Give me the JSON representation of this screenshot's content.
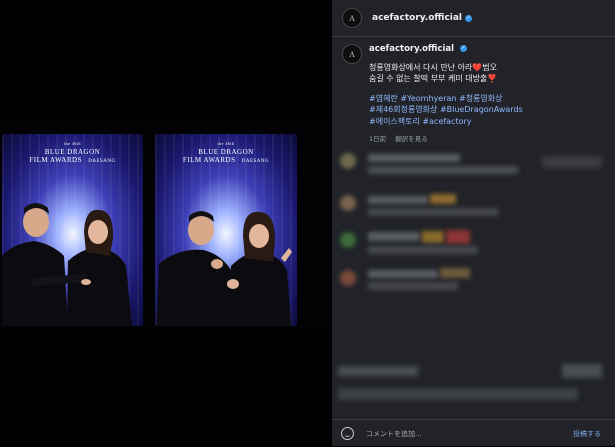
{
  "post": {
    "username": "acefactory.official",
    "caption_user": "acefactory.official",
    "caption_line1": "청룡영화상에서 다시 만난 아라❤️범오",
    "caption_line2": "숨길 수 없는 찰떡 부부 케미 대방출❣️",
    "hashtags_line1": "#염혜란 #Yeomhyeran #청룡영화상",
    "hashtags_line2": "#제46회청룡영화상 #BlueDragonAwards",
    "hashtags_line3": "#에이스팩토리 #acefactory",
    "time_ago": "1日前",
    "translate_label": "翻訳を見る",
    "avatar_letter": "A"
  },
  "photo": {
    "brand_small": "the 46th",
    "brand_line1": "BLUE DRAGON",
    "brand_line2": "FILM AWARDS",
    "sponsor": "DAESANG"
  },
  "comment_box": {
    "placeholder": "コメントを追加...",
    "post_label": "投稿する"
  },
  "colors": {
    "panel_bg": "#212328",
    "hashtag": "#8fb8ff",
    "verified": "#3897f0"
  }
}
